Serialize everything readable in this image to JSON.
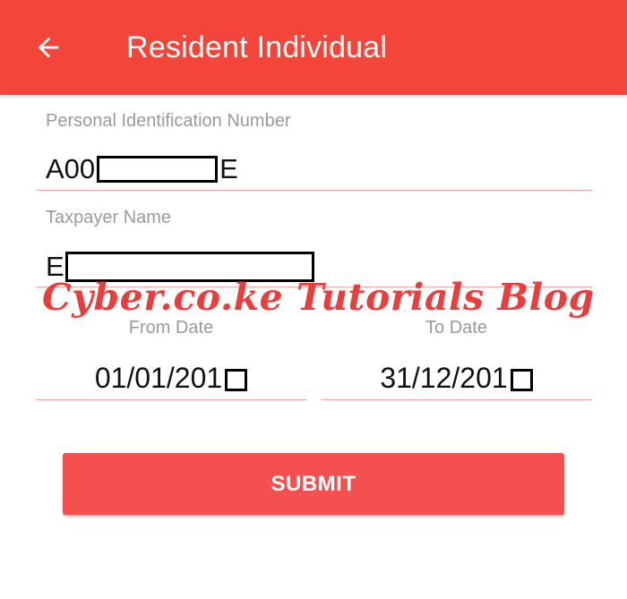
{
  "app_bar": {
    "back_icon": "arrow-left-icon",
    "title": "Resident Individual",
    "color": "#f4453a"
  },
  "pin": {
    "label": "Personal Identification Number",
    "value_prefix": "A00",
    "value_suffix": "E"
  },
  "taxpayer": {
    "label": "Taxpayer Name",
    "value_prefix": "E"
  },
  "watermark": "Cyber.co.ke Tutorials Blog",
  "from_date": {
    "label": "From Date",
    "value": "01/01/201"
  },
  "to_date": {
    "label": "To Date",
    "value": "31/12/201"
  },
  "submit": {
    "label": "SUBMIT",
    "color": "#f45050"
  }
}
